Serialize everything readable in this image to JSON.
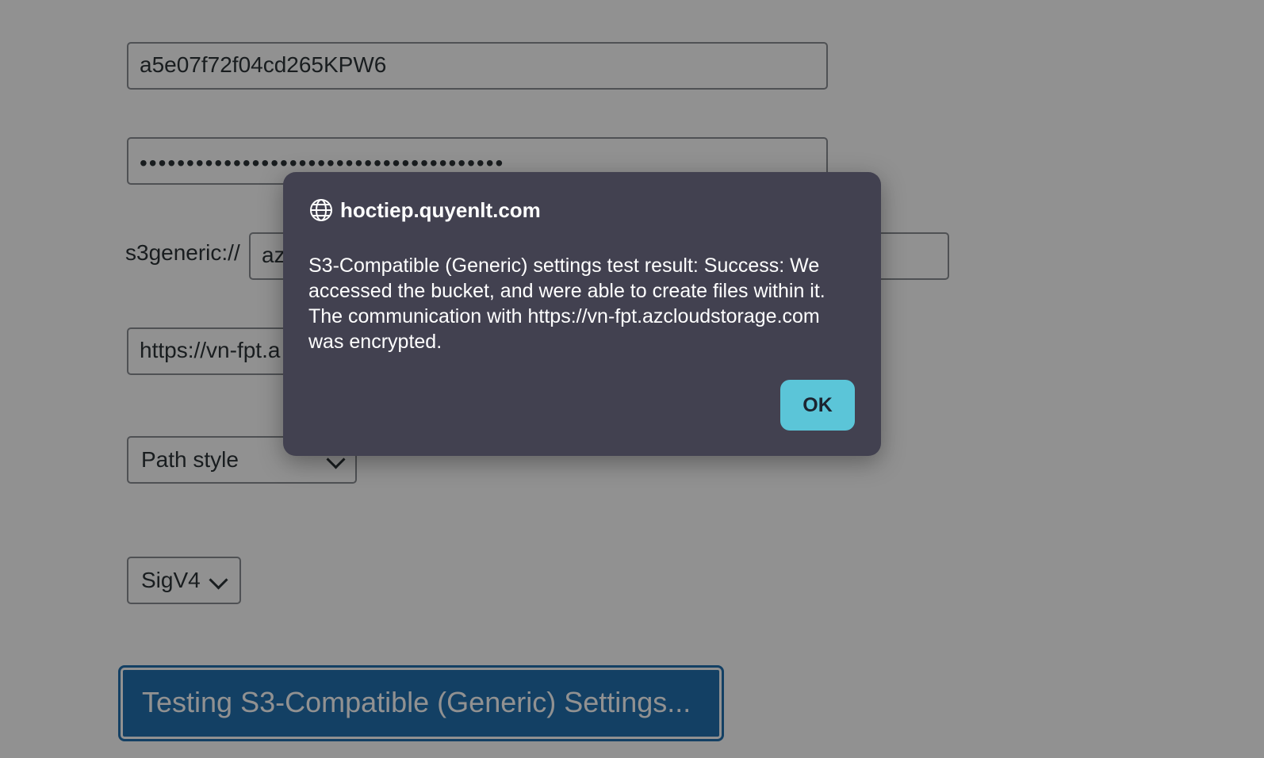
{
  "form": {
    "access_key_value": "a5e07f72f04cd265KPW6",
    "secret_key_value": "•••••••••••••••••••••••••••••••••••••••",
    "bucket_prefix": "s3generic://",
    "bucket_path_value": "az",
    "endpoint_value": "https://vn-fpt.a",
    "url_style_selected": "Path style",
    "signature_version_selected": "SigV4",
    "test_button_label": "Testing S3-Compatible (Generic) Settings..."
  },
  "dialog": {
    "origin": "hoctiep.quyenlt.com",
    "icon": "globe-icon",
    "message": "S3-Compatible (Generic) settings test result: Success: We accessed the bucket, and were able to create files within it. The communication with https://vn-fpt.azcloudstorage.com was encrypted.",
    "ok_label": "OK"
  },
  "colors": {
    "dialog_background": "#424150",
    "ok_button": "#5bc5d8",
    "primary_button": "#2271b1",
    "overlay": "rgba(0,0,0,0.43)"
  }
}
